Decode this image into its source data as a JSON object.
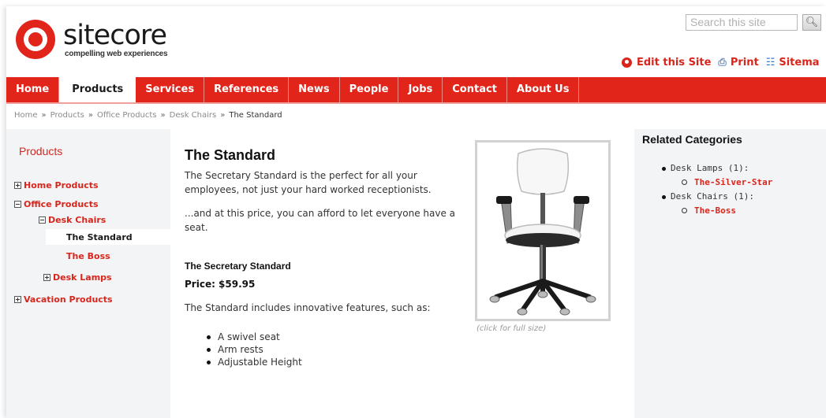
{
  "header": {
    "logo_text": "sitecore",
    "logo_tagline": "compelling web experiences",
    "search_placeholder": "Search this site",
    "search_icon": "magnifier-icon",
    "tools": [
      {
        "label": "Edit this Site",
        "icon": "edit-icon"
      },
      {
        "label": "Print",
        "icon": "print-icon"
      },
      {
        "label": "Sitema",
        "icon": "sitemap-icon"
      }
    ]
  },
  "nav": {
    "tabs": [
      "Home",
      "Products",
      "Services",
      "References",
      "News",
      "People",
      "Jobs",
      "Contact",
      "About Us"
    ],
    "active": "Products"
  },
  "breadcrumb": {
    "items": [
      "Home",
      "Products",
      "Office Products",
      "Desk Chairs",
      "The Standard"
    ],
    "separator": "»"
  },
  "sidebar": {
    "title": "Products",
    "tree": [
      {
        "label": "Home Products",
        "state": "collapsed"
      },
      {
        "label": "Office Products",
        "state": "expanded"
      },
      {
        "label": "Desk Chairs",
        "state": "expanded"
      },
      {
        "label": "The Standard",
        "state": "selected"
      },
      {
        "label": "The Boss",
        "state": "leaf"
      },
      {
        "label": "Desk Lamps",
        "state": "collapsed"
      },
      {
        "label": "Vacation Products",
        "state": "collapsed"
      }
    ]
  },
  "main": {
    "title": "The Standard",
    "intro": "The Secretary Standard is the perfect for all your employees, not just your hard worked receptionists.",
    "tagline": "...and at this price, you can afford to let everyone have a seat.",
    "product_name": "The Secretary Standard",
    "price": "Price: $59.95",
    "features_intro": "The Standard includes innovative features, such as:",
    "features": [
      "A swivel seat",
      "Arm rests",
      "Adjustable Height"
    ],
    "image_caption": "(click for full size)"
  },
  "related": {
    "title": "Related Categories",
    "groups": [
      {
        "label": "Desk Lamps (1):",
        "items": [
          "The-Silver-Star"
        ]
      },
      {
        "label": "Desk Chairs (1):",
        "items": [
          "The-Boss"
        ]
      }
    ]
  },
  "colors": {
    "brand_red": "#e1251b",
    "link_red": "#d8261c",
    "sidebar_bg": "#f3f4f6"
  }
}
